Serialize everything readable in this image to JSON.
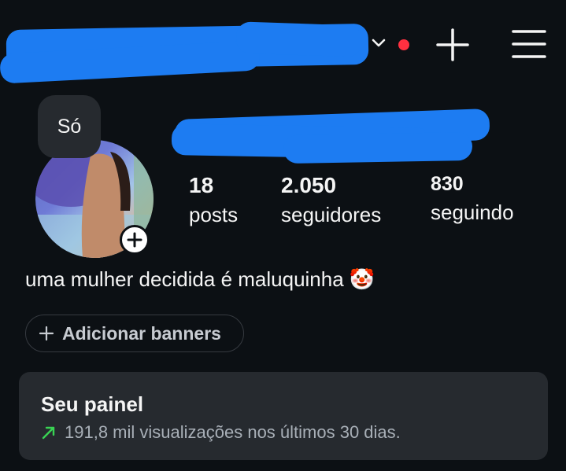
{
  "header": {
    "notification_dot_color": "#ff3040",
    "icons": [
      "chevron-down-icon",
      "plus-icon",
      "menu-icon"
    ]
  },
  "profile": {
    "note": "Só",
    "stats": {
      "posts": {
        "value": "18",
        "label": "posts"
      },
      "followers": {
        "value": "2.050",
        "label": "seguidores"
      },
      "following": {
        "value": "830",
        "label": "seguindo"
      }
    },
    "bio": "uma mulher decidida é maluquinha 🤡"
  },
  "actions": {
    "add_banners_label": "Adicionar banners"
  },
  "dashboard": {
    "title": "Seu painel",
    "subtitle": "191,8 mil visualizações nos últimos 30 dias.",
    "trend_color": "#39d353"
  }
}
